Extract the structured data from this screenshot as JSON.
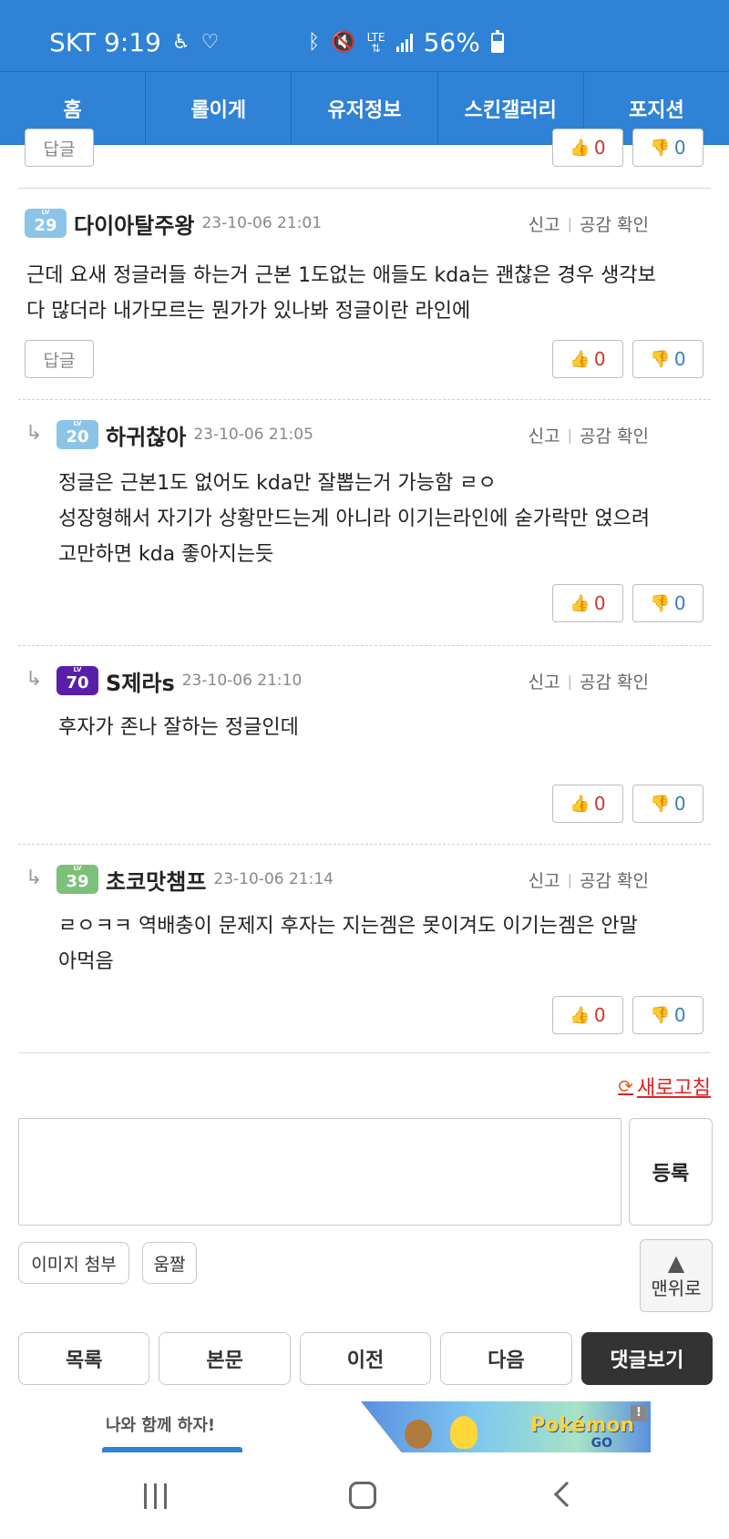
{
  "status_bar": {
    "carrier_time": "SKT 9:19",
    "lte": "LTE",
    "battery": "56%",
    "battery_level": 0.56
  },
  "nav": {
    "tabs": [
      "홈",
      "롤이게",
      "유저정보",
      "스킨갤러리",
      "포지션"
    ]
  },
  "top_partial": {
    "reply_label": "답글",
    "up": "0",
    "down": "0"
  },
  "comments": [
    {
      "level": "29",
      "level_color": "#8cc4e8",
      "author": "다이아탈주왕",
      "date": "23-10-06 21:01",
      "report": "신고",
      "like_check": "공감 확인",
      "body": [
        "근데 요새 정글러들 하는거 근본 1도없는 애들도 kda는 괜찮은 경우 생각보",
        "다 많더라 내가모르는 뭔가가 있나봐 정글이란 라인에"
      ],
      "reply_label": "답글",
      "up": "0",
      "down": "0"
    },
    {
      "level": "20",
      "level_color": "#8cc4e8",
      "author": "하귀찮아",
      "date": "23-10-06 21:05",
      "report": "신고",
      "like_check": "공감 확인",
      "body": [
        "정글은 근본1도 없어도 kda만 잘뽑는거 가능함 ㄹㅇ",
        "성장형해서 자기가 상황만드는게 아니라 이기는라인에 숟가락만 얹으려",
        "고만하면 kda 좋아지는듯"
      ],
      "up": "0",
      "down": "0"
    },
    {
      "level": "70",
      "level_color": "#5a1fa8",
      "author": "S제라s",
      "date": "23-10-06 21:10",
      "report": "신고",
      "like_check": "공감 확인",
      "body": [
        "후자가 존나 잘하는 정글인데"
      ],
      "up": "0",
      "down": "0"
    },
    {
      "level": "39",
      "level_color": "#7cc07a",
      "author": "초코맛챔프",
      "date": "23-10-06 21:14",
      "report": "신고",
      "like_check": "공감 확인",
      "body": [
        "ㄹㅇㅋㅋ 역배충이 문제지 후자는 지는겜은 못이겨도 이기는겜은 안말",
        "아먹음"
      ],
      "up": "0",
      "down": "0"
    }
  ],
  "form": {
    "refresh": "새로고침",
    "submit": "등록",
    "attach_image": "이미지 첨부",
    "umjjal": "움짤",
    "to_top": "맨위로"
  },
  "bottom_nav": [
    "목록",
    "본문",
    "이전",
    "다음",
    "댓글보기"
  ],
  "ad": {
    "text": "나와 함께 하자!",
    "brand": "Pokémon",
    "brand_sub": "GO",
    "info": "!"
  },
  "icons": {
    "reply_arrow": "reply-arrow-icon",
    "thumb_up": "thumbs-up-icon",
    "thumb_down": "thumbs-down-icon",
    "refresh": "refresh-icon"
  }
}
